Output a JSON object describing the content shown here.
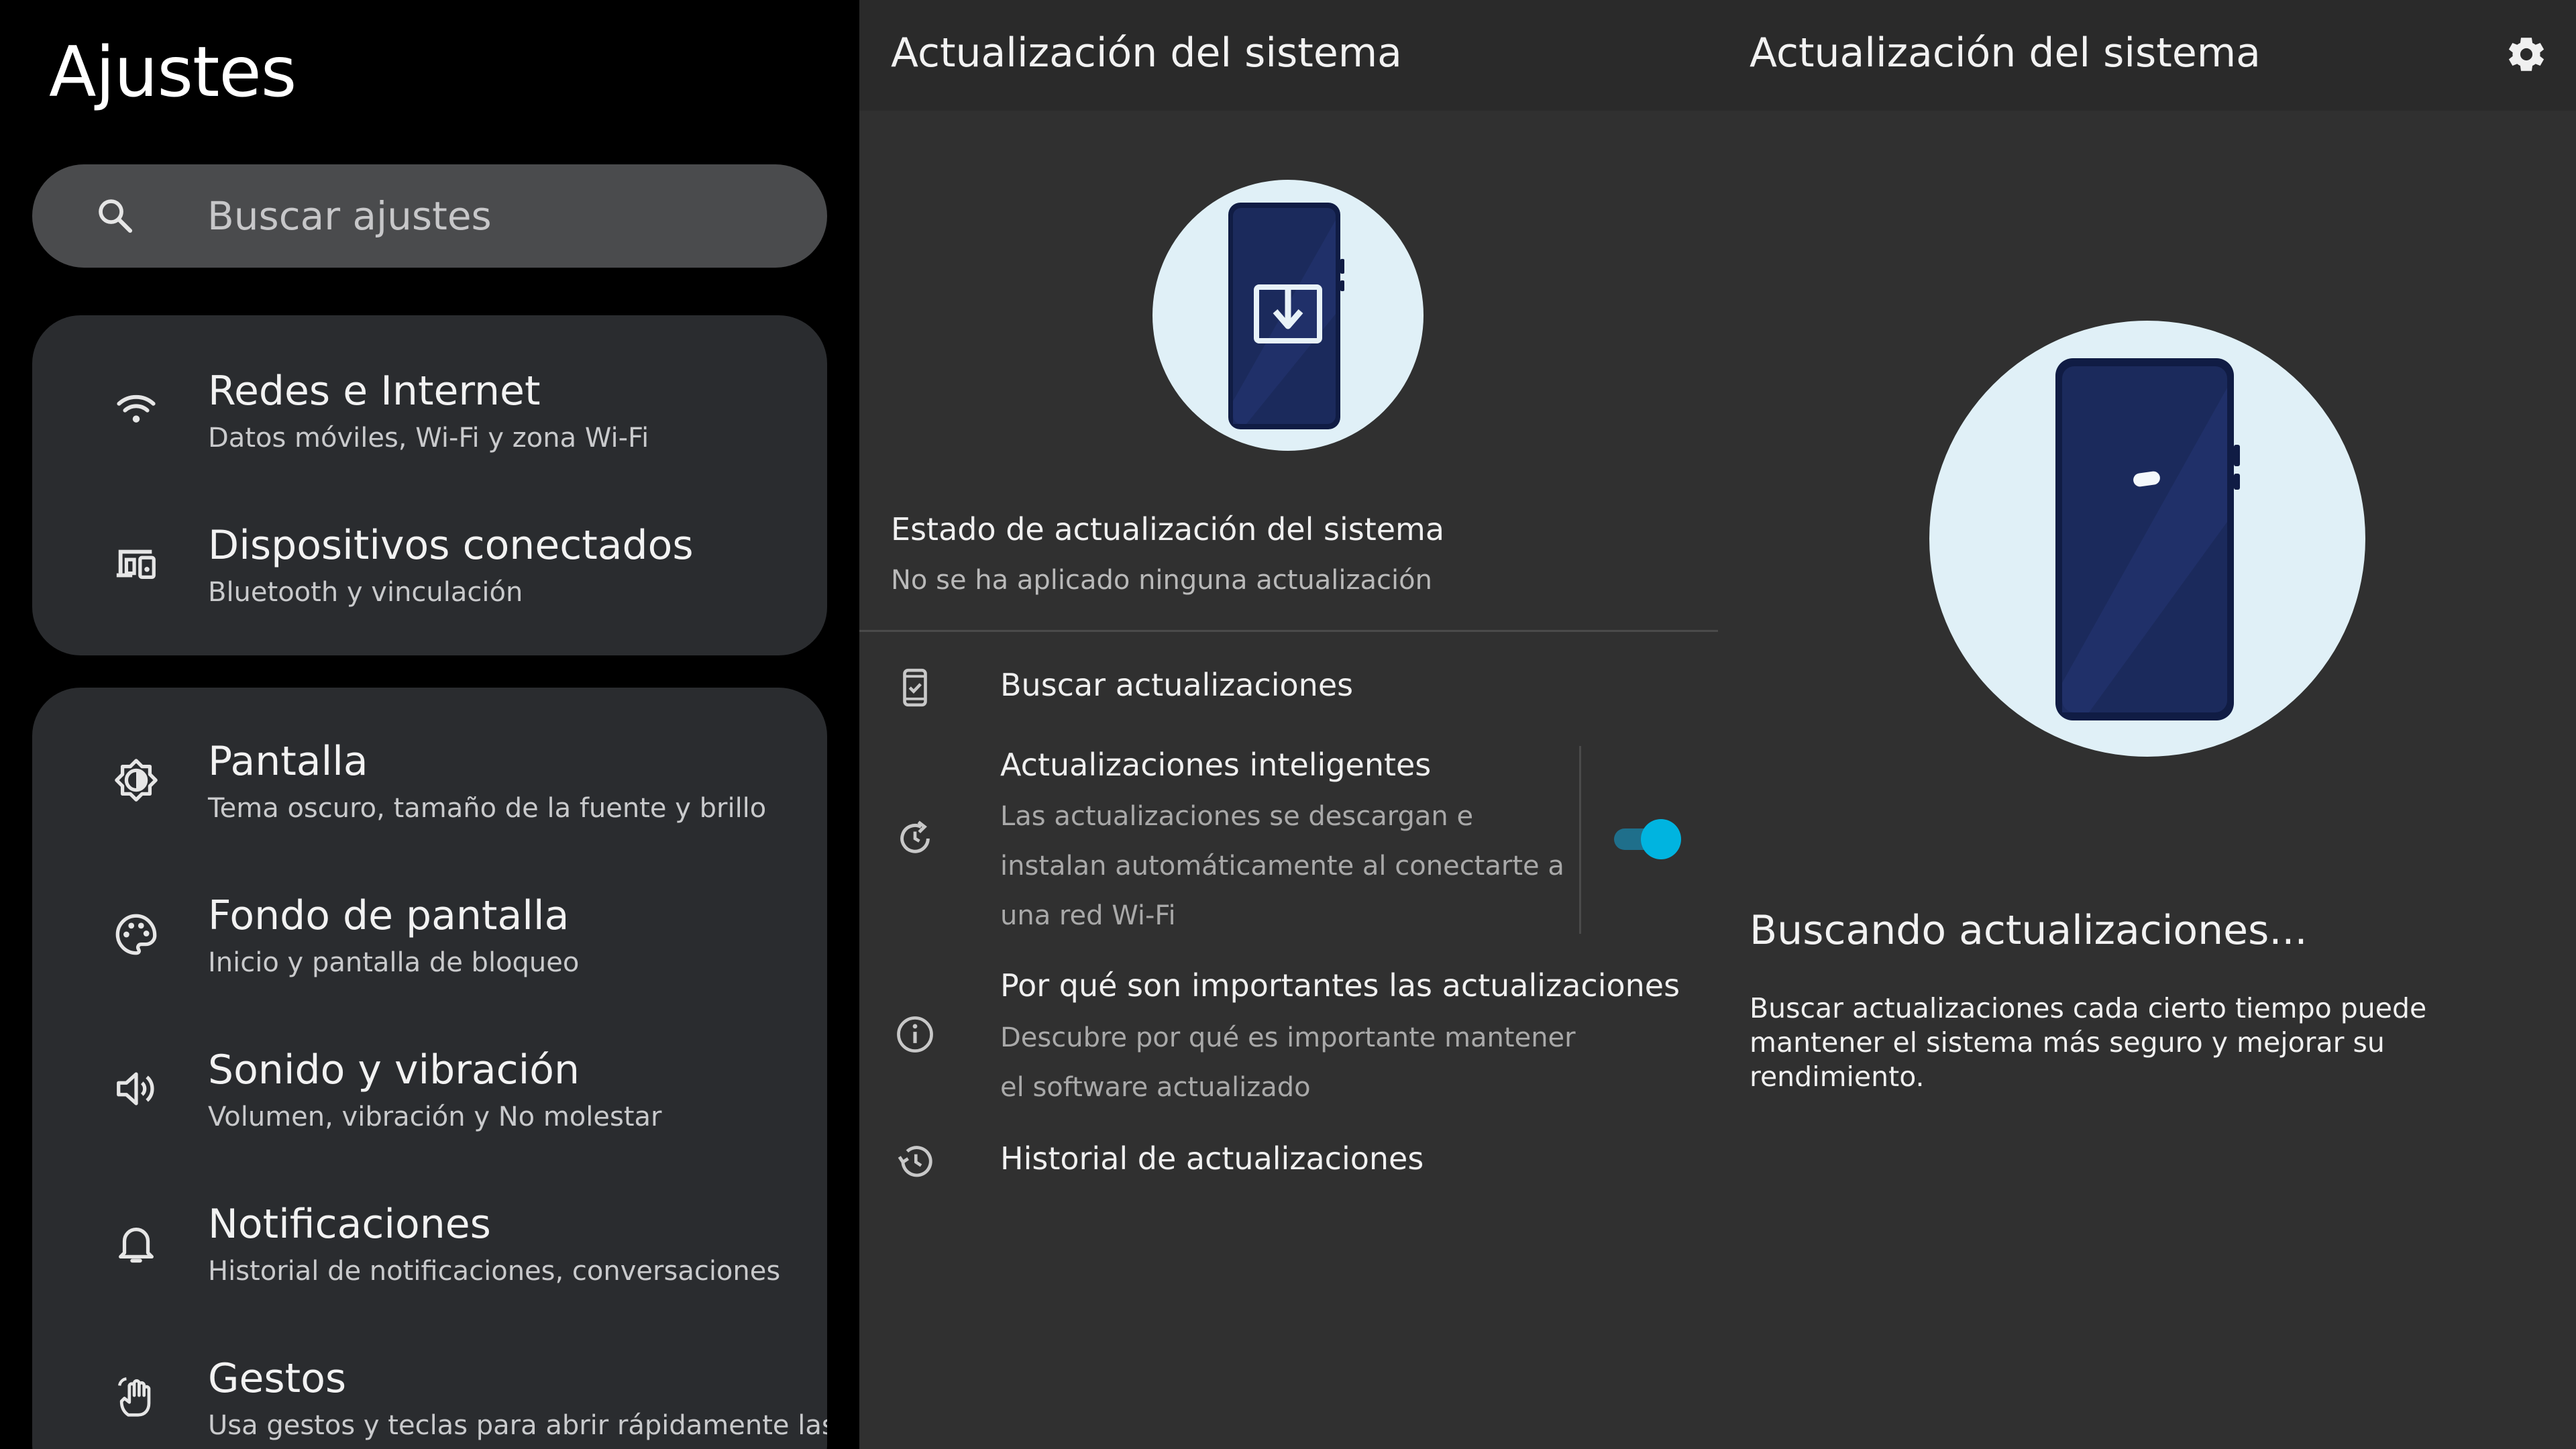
{
  "settings": {
    "title": "Ajustes",
    "search_placeholder": "Buscar ajustes",
    "group1": [
      {
        "title": "Redes e Internet",
        "subtitle": "Datos móviles, Wi-Fi y zona Wi-Fi",
        "icon": "wifi-icon"
      },
      {
        "title": "Dispositivos conectados",
        "subtitle": "Bluetooth y vinculación",
        "icon": "devices-icon"
      }
    ],
    "group2": [
      {
        "title": "Pantalla",
        "subtitle": "Tema oscuro, tamaño de la fuente y brillo",
        "icon": "brightness-icon"
      },
      {
        "title": "Fondo de pantalla",
        "subtitle": "Inicio y pantalla de bloqueo",
        "icon": "palette-icon"
      },
      {
        "title": "Sonido y vibración",
        "subtitle": "Volumen, vibración y No molestar",
        "icon": "volume-icon"
      },
      {
        "title": "Notificaciones",
        "subtitle": "Historial de notificaciones, conversaciones",
        "icon": "bell-icon"
      },
      {
        "title": "Gestos",
        "subtitle": "Usa gestos y teclas para abrir rápidamente las",
        "icon": "gesture-hand-icon"
      }
    ]
  },
  "system_update": {
    "title": "Actualización del sistema",
    "status_title": "Estado de actualización del sistema",
    "status_subtitle": "No se ha aplicado ninguna actualización",
    "options": [
      {
        "title": "Buscar actualizaciones",
        "icon": "phone-check-icon"
      },
      {
        "title": "Actualizaciones inteligentes",
        "subtitle": "Las actualizaciones se descargan e instalan automáticamente al conectarte a una red Wi-Fi",
        "icon": "auto-update-icon",
        "toggle_on": true
      },
      {
        "title": "Por qué son importantes las actualizaciones",
        "subtitle": "Descubre por qué es importante mantener el software actualizado",
        "icon": "info-icon"
      },
      {
        "title": "Historial de actualizaciones",
        "icon": "history-icon"
      }
    ]
  },
  "checking": {
    "title": "Actualización del sistema",
    "heading": "Buscando actualizaciones...",
    "description": "Buscar actualizaciones cada cierto tiempo puede mantener el sistema más seguro y mejorar su rendimiento.",
    "icon": "gear-icon"
  },
  "colors": {
    "toggle_accent": "#00b4e0",
    "card_bg": "#2a2c2f",
    "pane_bg": "#303030",
    "illustration_circle": "#e0f0f7",
    "phone_body": "#1b2a5c"
  }
}
